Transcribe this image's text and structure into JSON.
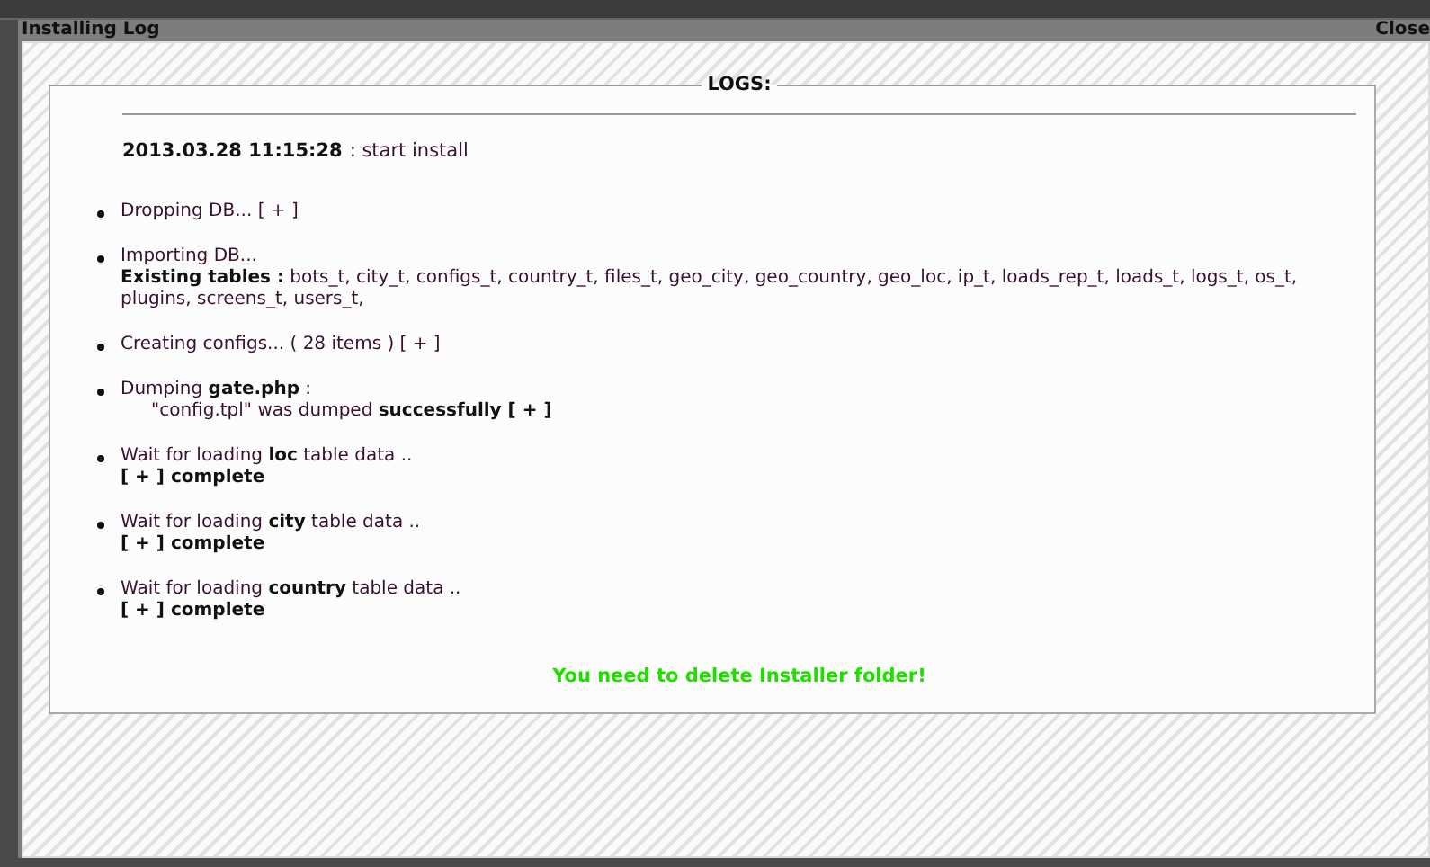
{
  "window": {
    "title": "Installing Log",
    "close": "Close"
  },
  "logs": {
    "legend": "LOGS:",
    "timestamp": "2013.03.28 11:15:28",
    "start": ": start install",
    "items": [
      {
        "lines": [
          {
            "kind": "plain",
            "text": "Dropping DB... [ + ]"
          }
        ]
      },
      {
        "lines": [
          {
            "kind": "plain",
            "text": "Importing DB..."
          },
          {
            "kind": "plain",
            "text": "**Existing tables :** bots_t, city_t, configs_t, country_t, files_t, geo_city, geo_country, geo_loc, ip_t, loads_rep_t, loads_t, logs_t, os_t, plugins, screens_t, users_t,"
          }
        ]
      },
      {
        "lines": [
          {
            "kind": "plain",
            "text": "Creating configs... ( 28 items ) [ + ]"
          }
        ]
      },
      {
        "lines": [
          {
            "kind": "plain",
            "text": "Dumping **gate.php** :"
          },
          {
            "kind": "indent",
            "text": "\"config.tpl\" was dumped **successfully [ + ]**"
          }
        ]
      },
      {
        "lines": [
          {
            "kind": "plain",
            "text": "Wait for loading **loc** table data .."
          },
          {
            "kind": "plain",
            "text": "**[ + ] complete**"
          }
        ]
      },
      {
        "lines": [
          {
            "kind": "plain",
            "text": "Wait for loading **city** table data .."
          },
          {
            "kind": "plain",
            "text": "**[ + ] complete**"
          }
        ]
      },
      {
        "lines": [
          {
            "kind": "plain",
            "text": "Wait for loading **country** table data .."
          },
          {
            "kind": "plain",
            "text": "**[ + ] complete**"
          }
        ]
      }
    ],
    "notice": "You need to delete Installer folder!"
  }
}
